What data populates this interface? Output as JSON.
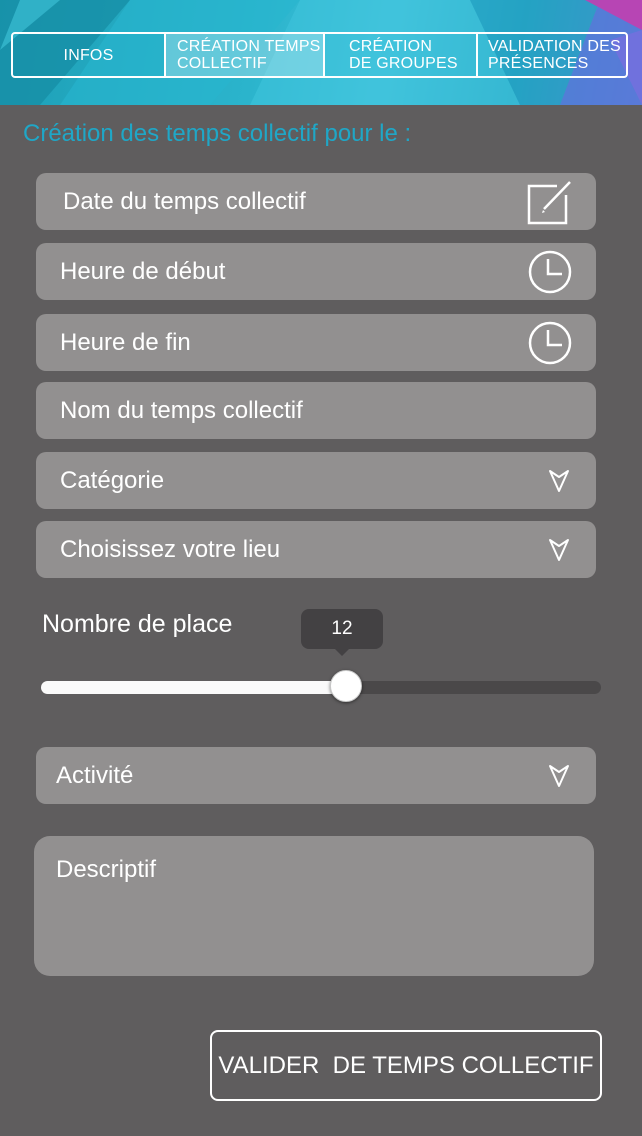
{
  "tabs": [
    {
      "label": "INFOS",
      "active": false
    },
    {
      "label": "CRÉATION TEMPS COLLECTIF",
      "active": true
    },
    {
      "label": "CRÉATION DE GROUPES",
      "active": false
    },
    {
      "label": "VALIDATION DES PRÉSENCES",
      "active": false
    }
  ],
  "form": {
    "title": "Création des temps collectif pour le :",
    "date_label": "Date du temps collectif",
    "start_label": "Heure de début",
    "end_label": "Heure de fin",
    "name_label": "Nom du temps collectif",
    "category_label": "Catégorie",
    "place_label": "Choisissez votre lieu",
    "seats_label": "Nombre de place",
    "seats_value": "12",
    "seats_fraction": 0.545,
    "activity_label": "Activité",
    "description_placeholder": "Descriptif",
    "submit_label": "VALIDER  DE TEMPS COLLECTIF"
  },
  "icons": {
    "date": "edit-icon",
    "time": "clock-icon",
    "dropdown": "chevron-down-icon"
  },
  "colors": {
    "background": "#5f5d5e",
    "field": "#929090",
    "accent": "#1fa7c7",
    "text": "#ffffff"
  }
}
